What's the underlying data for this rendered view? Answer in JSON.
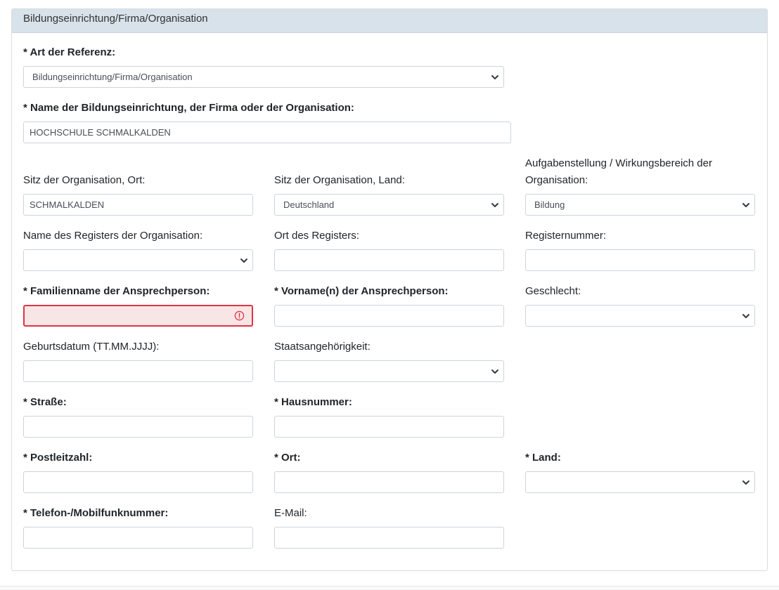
{
  "section": {
    "title": "Bildungseinrichtung/Firma/Organisation"
  },
  "fields": {
    "art_referenz": {
      "label": "* Art der Referenz:",
      "value": "Bildungseinrichtung/Firma/Organisation"
    },
    "name_org": {
      "label": "* Name der Bildungseinrichtung, der Firma oder der Organisation:",
      "value": "HOCHSCHULE SCHMALKALDEN"
    },
    "sitz_ort": {
      "label": "Sitz der Organisation, Ort:",
      "value": "SCHMALKALDEN"
    },
    "sitz_land": {
      "label": "Sitz der Organisation, Land:",
      "value": "Deutschland"
    },
    "aufgabe": {
      "label": "Aufgabenstellung / Wirkungsbereich der Organisation:",
      "value": "Bildung"
    },
    "register_name": {
      "label": "Name des Registers der Organisation:",
      "value": ""
    },
    "register_ort": {
      "label": "Ort des Registers:",
      "value": ""
    },
    "registernummer": {
      "label": "Registernummer:",
      "value": ""
    },
    "familienname": {
      "label": "* Familienname der Ansprechperson:",
      "value": ""
    },
    "vorname": {
      "label": "* Vorname(n) der Ansprechperson:",
      "value": ""
    },
    "geschlecht": {
      "label": "Geschlecht:",
      "value": ""
    },
    "geburtsdatum": {
      "label": "Geburtsdatum (TT.MM.JJJJ):",
      "value": ""
    },
    "staatsangehoerigkeit": {
      "label": "Staatsangehörigkeit:",
      "value": ""
    },
    "strasse": {
      "label": "* Straße:",
      "value": ""
    },
    "hausnummer": {
      "label": "* Hausnummer:",
      "value": ""
    },
    "plz": {
      "label": "* Postleitzahl:",
      "value": ""
    },
    "ort": {
      "label": "* Ort:",
      "value": ""
    },
    "land": {
      "label": "* Land:",
      "value": ""
    },
    "telefon": {
      "label": "* Telefon-/Mobilfunknummer:",
      "value": ""
    },
    "email": {
      "label": "E-Mail:",
      "value": ""
    }
  },
  "icons": {
    "dropdown": "chevron-down-icon",
    "error": "error-circle-icon"
  },
  "colors": {
    "header_bg": "#d7e2ea",
    "error": "#dc3545",
    "error_bg": "#f8e5e6"
  }
}
